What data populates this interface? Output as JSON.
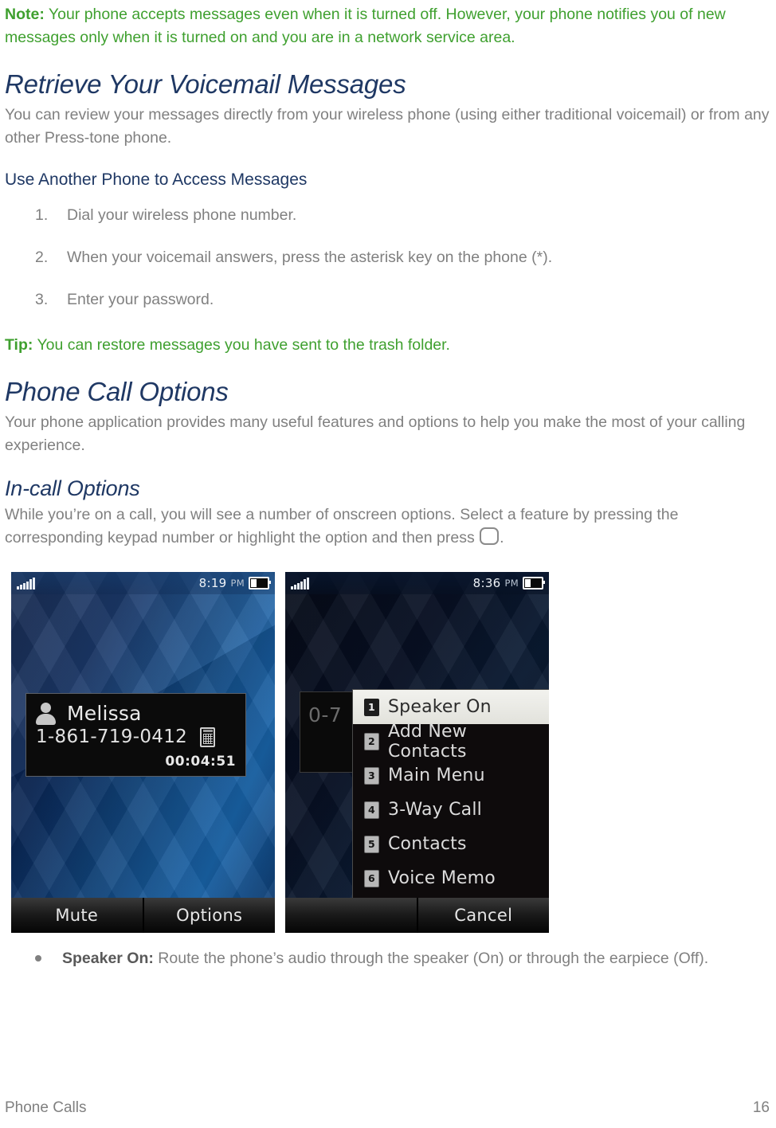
{
  "note": {
    "label": "Note:",
    "text": " Your phone accepts messages even when it is turned off. However, your phone notifies you of new messages only when it is turned on and you are in a network service area."
  },
  "section_voicemail": {
    "heading": "Retrieve Your Voicemail Messages",
    "intro": "You can review your messages directly from your wireless phone (using either traditional voicemail) or from any other Press-tone phone.",
    "subheading": "Use Another Phone to Access Messages",
    "steps": [
      {
        "num": "1.",
        "text": "Dial your wireless phone number."
      },
      {
        "num": "2.",
        "text": "When your voicemail answers, press the asterisk key on the phone (*)."
      },
      {
        "num": "3.",
        "text": "Enter your password."
      }
    ]
  },
  "tip": {
    "label": "Tip:",
    "text": " You can restore messages you have sent to the trash folder."
  },
  "section_options": {
    "heading": "Phone Call Options",
    "intro": "Your phone application provides many useful features and options to help you make the most of your calling experience.",
    "subheading": "In-call Options",
    "intro_part1": "While you’re on a call, you will see a number of onscreen options. Select a feature by pressing the corresponding keypad number or highlight the option and then press ",
    "intro_part2": "."
  },
  "figures": {
    "phone_left": {
      "status": {
        "signal": "signal-bars-icon",
        "time": "8:19",
        "ampm": "PM",
        "battery": "battery-low-icon"
      },
      "call": {
        "contact_icon": "person-icon",
        "name": "Melissa",
        "number": "1-861-719-0412",
        "device_icon": "handset-icon",
        "duration": "00:04:51"
      },
      "softkeys": {
        "left": "Mute",
        "right": "Options"
      }
    },
    "phone_right": {
      "status": {
        "signal": "signal-bars-icon",
        "time": "8:36",
        "ampm": "PM",
        "battery": "battery-low-icon"
      },
      "background_number": "0-7",
      "menu_items": [
        {
          "key": "1",
          "label": "Speaker On",
          "selected": true
        },
        {
          "key": "2",
          "label": "Add New Contacts",
          "selected": false
        },
        {
          "key": "3",
          "label": "Main Menu",
          "selected": false
        },
        {
          "key": "4",
          "label": "3-Way Call",
          "selected": false
        },
        {
          "key": "5",
          "label": "Contacts",
          "selected": false
        },
        {
          "key": "6",
          "label": "Voice Memo",
          "selected": false
        }
      ],
      "scroll_indicator": "chevron-down-icon",
      "softkeys": {
        "left": "",
        "right": "Cancel"
      }
    }
  },
  "bullets": [
    {
      "term": "Speaker On:",
      "text": " Route the phone’s audio through the speaker (On) or through the earpiece (Off)."
    }
  ],
  "footer": {
    "left": "Phone Calls",
    "page": "16"
  },
  "colors": {
    "heading": "#1F3864",
    "body": "#808080",
    "accent_green": "#3FA02F"
  }
}
